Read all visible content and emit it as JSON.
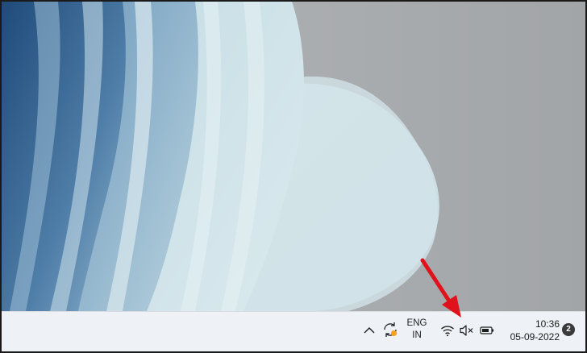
{
  "taskbar": {
    "language": {
      "line1": "ENG",
      "line2": "IN"
    },
    "clock": {
      "time": "10:36",
      "date": "05-09-2022"
    },
    "notifications": {
      "count": "2"
    },
    "icons": {
      "overflow": "chevron-up-icon",
      "sync": "sync-icon",
      "wifi": "wifi-icon",
      "volume": "volume-muted-icon",
      "battery": "battery-icon"
    }
  },
  "annotation": {
    "arrow_color": "#e0121b"
  },
  "colors": {
    "taskbar_bg": "#eef2f6",
    "wallpaper_gray": "#a9acae",
    "sync_dot": "#f7a21b"
  }
}
